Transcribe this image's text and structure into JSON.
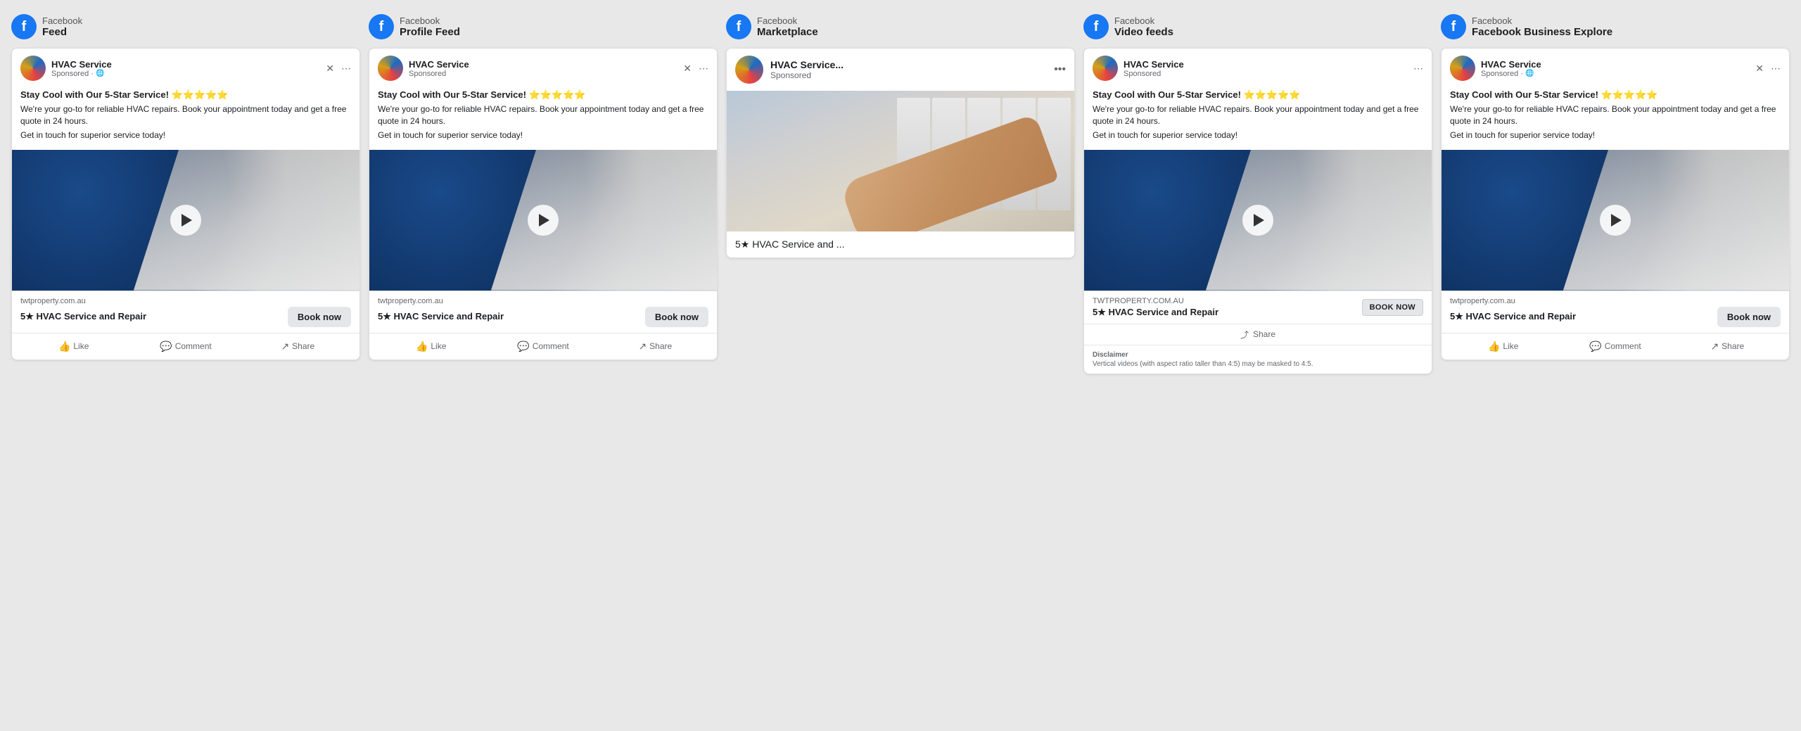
{
  "placements": [
    {
      "id": "facebook-feed",
      "platform": "Facebook",
      "name": "Feed",
      "ad": {
        "advertiser": "HVAC Service",
        "sponsored_label": "Sponsored · ",
        "title": "Stay Cool with Our 5-Star Service! ⭐⭐⭐⭐⭐",
        "title_emoji_extra": "⭐",
        "description": "We're your go-to for reliable HVAC repairs. Book your appointment today and get a free quote in 24 hours.",
        "cta_text": "Get in touch for superior service today!",
        "url": "twtproperty.com.au",
        "service_name": "5★ HVAC Service and Repair",
        "cta_button": "Book now",
        "actions": [
          "Like",
          "Comment",
          "Share"
        ],
        "has_video": true
      }
    },
    {
      "id": "facebook-profile-feed",
      "platform": "Facebook",
      "name": "Profile Feed",
      "ad": {
        "advertiser": "HVAC Service",
        "sponsored_label": "Sponsored",
        "title": "Stay Cool with Our 5-Star Service! ⭐⭐⭐⭐⭐",
        "title_emoji_extra": "⭐",
        "description": "We're your go-to for reliable HVAC repairs. Book your appointment today and get a free quote in 24 hours.",
        "cta_text": "Get in touch for superior service today!",
        "url": "twtproperty.com.au",
        "service_name": "5★ HVAC Service and Repair",
        "cta_button": "Book now",
        "actions": [
          "Like",
          "Comment",
          "Share"
        ],
        "has_video": true
      }
    },
    {
      "id": "facebook-marketplace",
      "platform": "Facebook",
      "name": "Marketplace",
      "ad": {
        "advertiser": "HVAC Service...",
        "sponsored_label": "Sponsored",
        "service_label": "5★ HVAC Service and ..."
      }
    },
    {
      "id": "facebook-video-feeds",
      "platform": "Facebook",
      "name": "Video feeds",
      "ad": {
        "advertiser": "HVAC Service",
        "sponsored_label": "Sponsored",
        "title": "Stay Cool with Our 5-Star Service! ⭐⭐⭐⭐⭐",
        "title_emoji_extra": "⭐",
        "description": "We're your go-to for reliable HVAC repairs. Book your appointment today and get a free quote in 24 hours.",
        "cta_text": "Get in touch for superior service today!",
        "url": "TWTPROPERTY.COM.AU",
        "service_name": "5★ HVAC Service and Repair",
        "cta_button": "BOOK NOW",
        "share_label": "Share",
        "has_video": true,
        "disclaimer_title": "Disclaimer",
        "disclaimer_text": "Vertical videos (with aspect ratio taller than 4:5) may be masked to 4:5."
      }
    },
    {
      "id": "facebook-business-explore",
      "platform": "Facebook",
      "name": "Facebook Business Explore",
      "ad": {
        "advertiser": "HVAC Service",
        "sponsored_label": "Sponsored · ",
        "title": "Stay Cool with Our 5-Star Service! ⭐⭐⭐⭐⭐",
        "title_emoji_extra": "⭐",
        "description": "We're your go-to for reliable HVAC repairs. Book your appointment today and get a free quote in 24 hours.",
        "cta_text": "Get in touch for superior service today!",
        "url": "twtproperty.com.au",
        "service_name": "5★ HVAC Service and Repair",
        "cta_button": "Book now",
        "actions": [
          "Like",
          "Comment",
          "Share"
        ],
        "has_video": true
      }
    }
  ],
  "icons": {
    "facebook": "f",
    "play": "▶",
    "like": "👍",
    "comment": "💬",
    "share": "↗",
    "close": "✕",
    "more": "⋯",
    "globe": "🌐",
    "share_icon": "⤴"
  }
}
